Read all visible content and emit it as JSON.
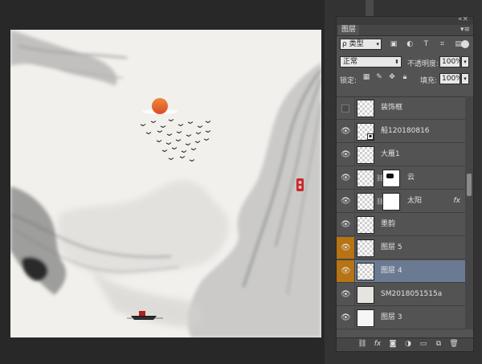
{
  "panel": {
    "collapse_icon": "double-chevron-icon",
    "tab_title": "图层",
    "tab_menu_icon": "panel-menu-icon"
  },
  "filter": {
    "kind_label": "ρ 类型",
    "icons": [
      "image-filter-icon",
      "adjustment-filter-icon",
      "type-filter-icon",
      "shape-filter-icon",
      "smartobject-filter-icon"
    ],
    "toggle_icon": "filter-toggle-icon"
  },
  "blend": {
    "mode": "正常",
    "opacity_label": "不透明度:",
    "opacity_value": "100%"
  },
  "lock": {
    "label": "锁定:",
    "icons": [
      "lock-transparent-icon",
      "lock-pixels-icon",
      "lock-position-icon",
      "lock-all-icon"
    ],
    "fill_label": "填充:",
    "fill_value": "100%"
  },
  "layers": [
    {
      "name": "装饰框",
      "visible": false,
      "thumb": "transparent",
      "marked": false,
      "selected": false
    },
    {
      "name": "船120180816",
      "visible": true,
      "thumb": "transparent",
      "smart": true,
      "marked": false,
      "selected": false
    },
    {
      "name": "大雁1",
      "visible": true,
      "thumb": "transparent",
      "marked": false,
      "selected": false
    },
    {
      "name": "云",
      "visible": true,
      "thumb": "transparent",
      "mask": true,
      "marked": false,
      "selected": false
    },
    {
      "name": "太阳",
      "visible": true,
      "thumb": "transparent",
      "mask": true,
      "fx": "fx",
      "marked": false,
      "selected": false
    },
    {
      "name": "墨韵",
      "visible": true,
      "thumb": "transparent",
      "marked": false,
      "selected": false
    },
    {
      "name": "图层 5",
      "visible": true,
      "thumb": "transparent",
      "marked": true,
      "selected": false
    },
    {
      "name": "图层 4",
      "visible": true,
      "thumb": "transparent",
      "marked": true,
      "selected": true
    },
    {
      "name": "SM2018051515a",
      "visible": true,
      "thumb": "photo",
      "marked": false,
      "selected": false
    },
    {
      "name": "图层 3",
      "visible": true,
      "thumb": "white",
      "marked": false,
      "selected": false
    }
  ],
  "footer_icons": [
    "link-layers-icon",
    "fx-icon",
    "add-mask-icon",
    "adjustment-layer-icon",
    "new-group-icon",
    "new-layer-icon",
    "delete-icon"
  ],
  "colors": {
    "accent_marked": "#b87313",
    "selected_row": "#6a7a93",
    "panel_bg": "#535353",
    "canvas_bg": "#f2f0ec",
    "sun": "#e0632e"
  }
}
